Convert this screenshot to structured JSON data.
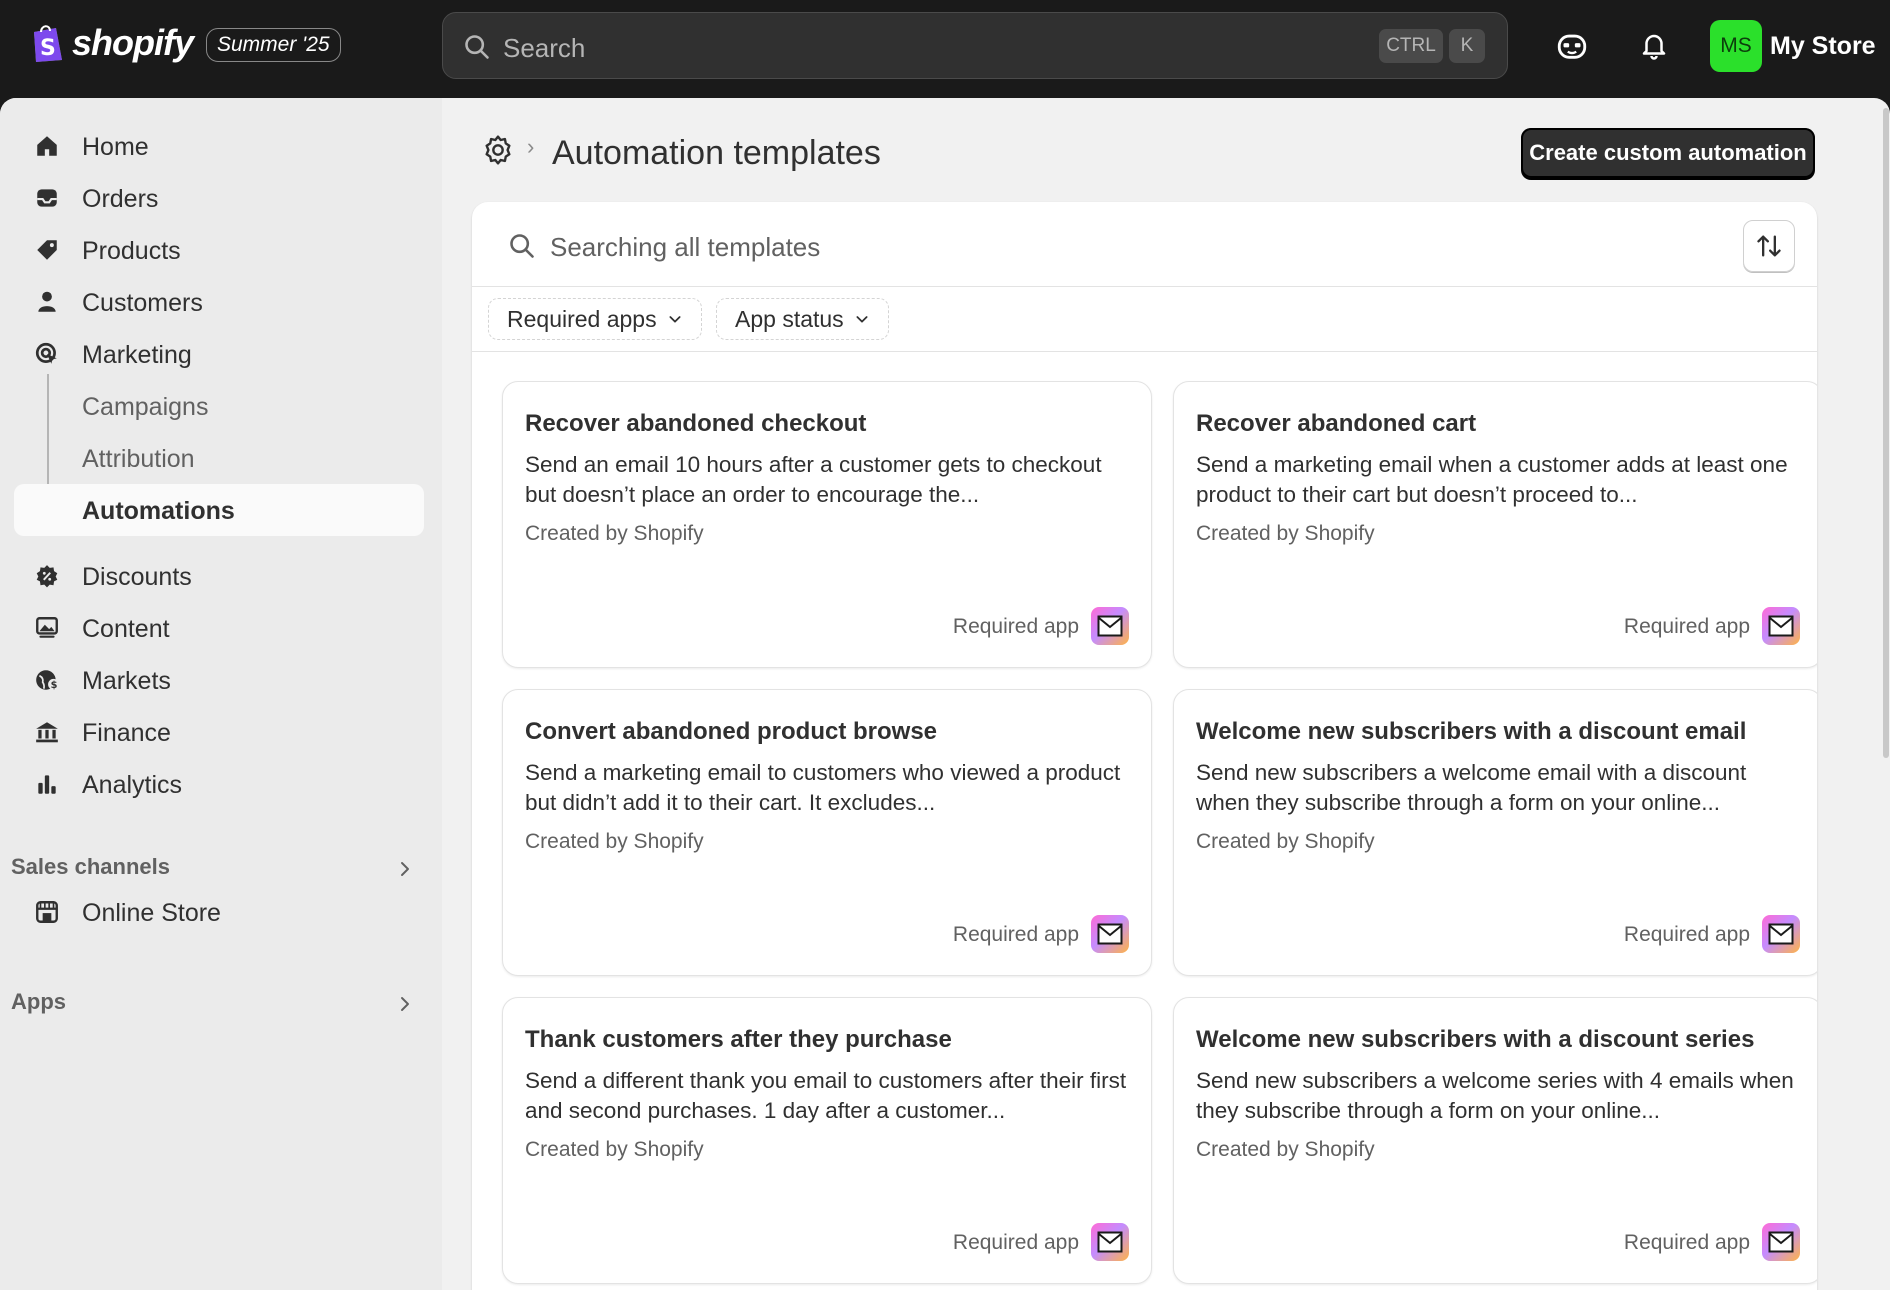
{
  "topbar": {
    "brand": "shopify",
    "edition": "Summer '25",
    "search_placeholder": "Search",
    "shortcut_ctrl": "CTRL",
    "shortcut_key": "K",
    "avatar_initials": "MS",
    "store_name": "My Store",
    "avatar_color": "#2be02b"
  },
  "sidebar": {
    "items": [
      {
        "label": "Home",
        "icon": "home-icon"
      },
      {
        "label": "Orders",
        "icon": "inbox-icon"
      },
      {
        "label": "Products",
        "icon": "tag-icon"
      },
      {
        "label": "Customers",
        "icon": "person-icon"
      },
      {
        "label": "Marketing",
        "icon": "target-icon"
      }
    ],
    "marketing_sub": [
      "Campaigns",
      "Attribution",
      "Automations"
    ],
    "active": "Automations",
    "items2": [
      {
        "label": "Discounts",
        "icon": "discount-icon"
      },
      {
        "label": "Content",
        "icon": "image-icon"
      },
      {
        "label": "Markets",
        "icon": "globe-icon"
      },
      {
        "label": "Finance",
        "icon": "bank-icon"
      },
      {
        "label": "Analytics",
        "icon": "bar-chart-icon"
      }
    ],
    "sales_channels_label": "Sales channels",
    "online_store": "Online Store",
    "apps_label": "Apps"
  },
  "page": {
    "title": "Automation templates",
    "primary_action": "Create custom automation",
    "template_search_placeholder": "Searching all templates",
    "filters": [
      "Required apps",
      "App status"
    ]
  },
  "templates": [
    {
      "title": "Recover abandoned checkout",
      "description": "Send an email 10 hours after a customer gets to checkout but doesn’t place an order to encourage the...",
      "creator": "Created by Shopify",
      "required": "Required app"
    },
    {
      "title": "Recover abandoned cart",
      "description": "Send a marketing email when a customer adds at least one product to their cart but doesn’t proceed to...",
      "creator": "Created by Shopify",
      "required": "Required app"
    },
    {
      "title": "Convert abandoned product browse",
      "description": "Send a marketing email to customers who viewed a product but didn’t add it to their cart. It excludes...",
      "creator": "Created by Shopify",
      "required": "Required app"
    },
    {
      "title": "Welcome new subscribers with a discount email",
      "description": "Send new subscribers a welcome email with a discount when they subscribe through a form on your online...",
      "creator": "Created by Shopify",
      "required": "Required app"
    },
    {
      "title": "Thank customers after they purchase",
      "description": "Send a different thank you email to customers after their first and second purchases. 1 day after a customer...",
      "creator": "Created by Shopify",
      "required": "Required app"
    },
    {
      "title": "Welcome new subscribers with a discount series",
      "description": "Send new subscribers a welcome series with 4 emails when they subscribe through a form on your online...",
      "creator": "Created by Shopify",
      "required": "Required app"
    }
  ]
}
